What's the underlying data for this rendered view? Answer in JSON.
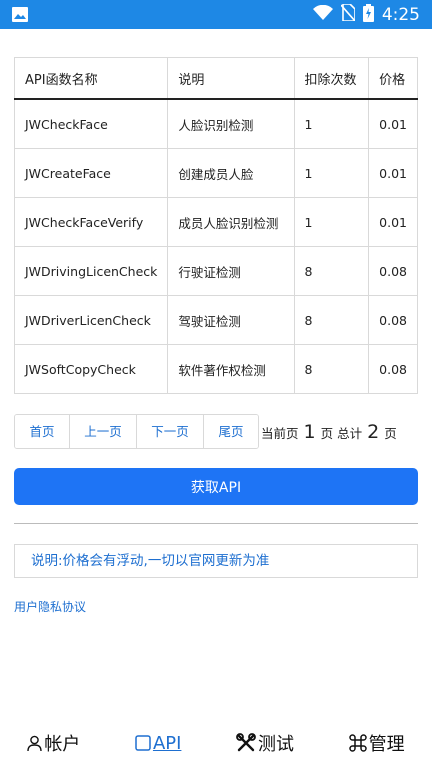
{
  "status_bar": {
    "time": "4:25"
  },
  "table": {
    "headers": [
      "API函数名称",
      "说明",
      "扣除次数",
      "价格"
    ],
    "rows": [
      {
        "name": "JWCheckFace",
        "desc": "人脸识别检测",
        "count": "1",
        "price": "0.01"
      },
      {
        "name": "JWCreateFace",
        "desc": "创建成员人脸",
        "count": "1",
        "price": "0.01"
      },
      {
        "name": "JWCheckFaceVerify",
        "desc": "成员人脸识别检测",
        "count": "1",
        "price": "0.01"
      },
      {
        "name": "JWDrivingLicenCheck",
        "desc": "行驶证检测",
        "count": "8",
        "price": "0.08"
      },
      {
        "name": "JWDriverLicenCheck",
        "desc": "驾驶证检测",
        "count": "8",
        "price": "0.08"
      },
      {
        "name": "JWSoftCopyCheck",
        "desc": "软件著作权检测",
        "count": "8",
        "price": "0.08"
      }
    ]
  },
  "pager": {
    "first": "首页",
    "prev": "上一页",
    "next": "下一页",
    "last": "尾页",
    "current_prefix": "当前页",
    "current_page": "1",
    "current_suffix": "页",
    "total_prefix": "总计",
    "total_pages": "2",
    "total_suffix": "页"
  },
  "fetch_button": "获取API",
  "notice": "说明:价格会有浮动,一切以官网更新为准",
  "privacy_link": "用户隐私协议",
  "nav": {
    "account": "帐户",
    "api": "API",
    "test": "测试",
    "manage": "管理"
  },
  "colors": {
    "accent": "#1e74f5",
    "link": "#1e6fd0",
    "status_bar": "#1e88e5"
  }
}
